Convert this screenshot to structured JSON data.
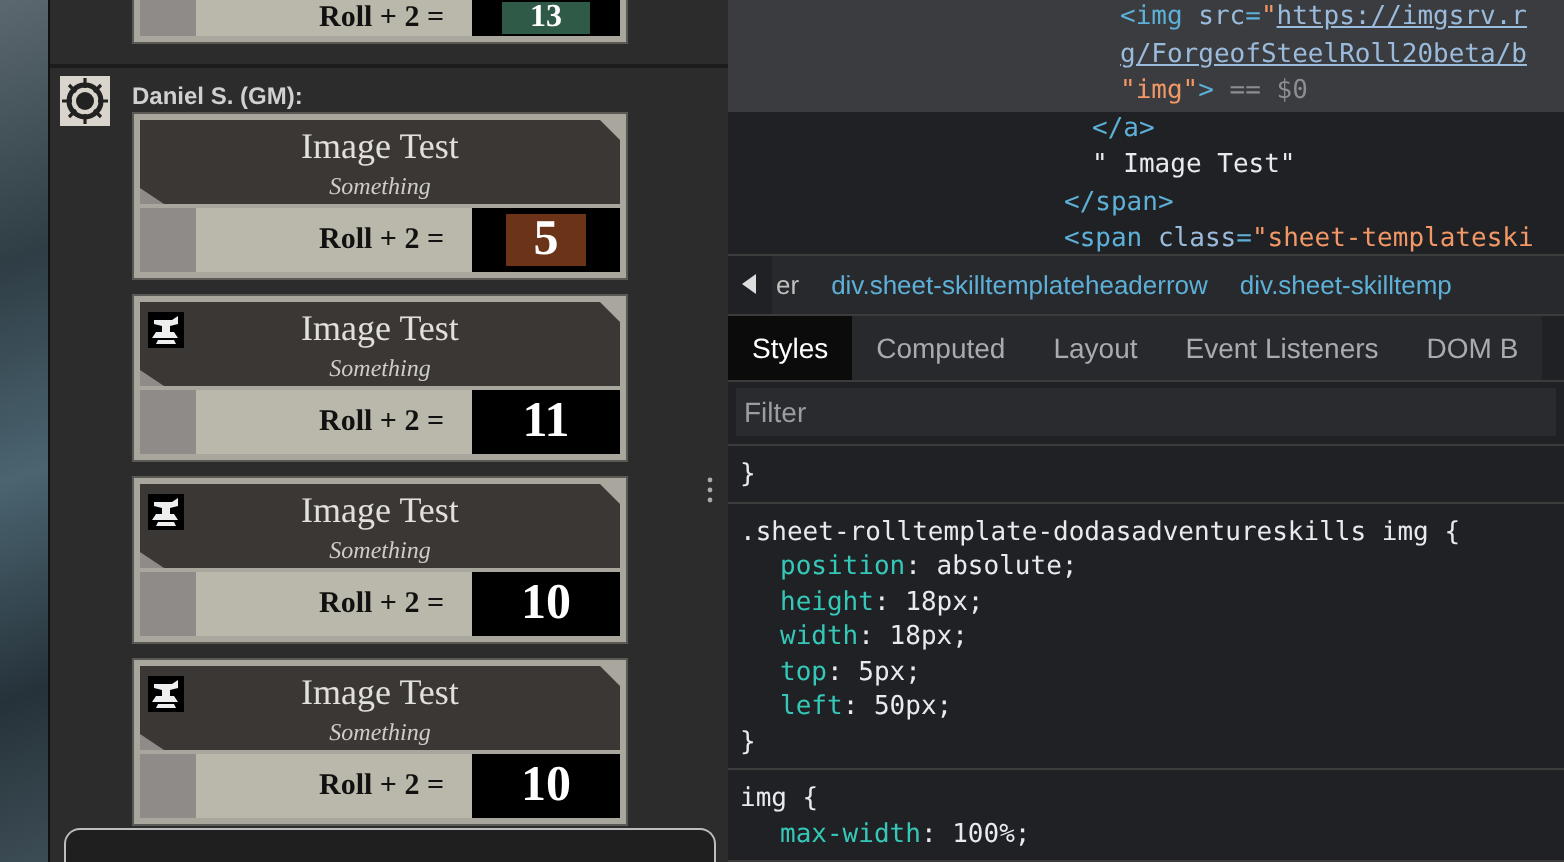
{
  "previous_roll": {
    "label": "Roll + 2 =",
    "result": "13",
    "color": "#2f5a47"
  },
  "message": {
    "sender": "Daniel S. (GM):",
    "rolls": [
      {
        "title": "Image Test",
        "subtitle": "Something",
        "label": "Roll + 2 =",
        "result": "5",
        "color": "#6b3419",
        "icon": false
      },
      {
        "title": "Image Test",
        "subtitle": "Something",
        "label": "Roll + 2 =",
        "result": "11",
        "color": "#000000",
        "icon": true
      },
      {
        "title": "Image Test",
        "subtitle": "Something",
        "label": "Roll + 2 =",
        "result": "10",
        "color": "#000000",
        "icon": true
      },
      {
        "title": "Image Test",
        "subtitle": "Something",
        "label": "Roll + 2 =",
        "result": "10",
        "color": "#000000",
        "icon": true
      }
    ]
  },
  "devtools": {
    "dom_tree": [
      {
        "children": [
          {
            "children": [
              {
                "selected": true,
                "lines": [
                  [
                    {
                      "kind": "tag",
                      "text": "<img "
                    },
                    {
                      "kind": "attr",
                      "text": "src"
                    },
                    {
                      "kind": "tag",
                      "text": "="
                    },
                    {
                      "kind": "value",
                      "text": "\""
                    },
                    {
                      "kind": "link",
                      "text": "https://imgsrv.r"
                    }
                  ],
                  [
                    {
                      "kind": "link",
                      "text": "g/ForgeofSteelRoll20beta/b"
                    }
                  ],
                  [
                    {
                      "kind": "value",
                      "text": "\"img\""
                    },
                    {
                      "kind": "tag",
                      "text": ">"
                    },
                    {
                      "kind": "muted",
                      "text": " == $0"
                    }
                  ]
                ]
              }
            ]
          },
          {
            "selected": false,
            "lines": [
              [
                {
                  "kind": "tag",
                  "text": "</a>"
                }
              ]
            ]
          },
          {
            "selected": false,
            "lines": [
              [
                {
                  "kind": "text",
                  "text": "\" Image Test\""
                }
              ]
            ]
          }
        ]
      },
      {
        "selected": false,
        "lines": [
          [
            {
              "kind": "tag",
              "text": "</span>"
            }
          ]
        ]
      },
      {
        "selected": false,
        "lines": [
          [
            {
              "kind": "tag",
              "text": "<span "
            },
            {
              "kind": "attr",
              "text": "class"
            },
            {
              "kind": "tag",
              "text": "="
            },
            {
              "kind": "value",
              "text": "\"sheet-templateski"
            }
          ]
        ]
      }
    ],
    "breadcrumbs": [
      "er",
      "div.sheet-skilltemplateheaderrow",
      "div.sheet-skilltemp"
    ],
    "tabs": [
      {
        "label": "Styles",
        "selected": true
      },
      {
        "label": "Computed",
        "selected": false
      },
      {
        "label": "Layout",
        "selected": false
      },
      {
        "label": "Event Listeners",
        "selected": false
      },
      {
        "label": "DOM B",
        "selected": false
      }
    ],
    "filter": {
      "placeholder": "Filter"
    },
    "rules": [
      {
        "lines": [
          {
            "kind": "brace",
            "text": "}"
          }
        ]
      },
      {
        "lines": [
          {
            "kind": "selector",
            "text": ".sheet-rolltemplate-dodasadventureskills img {"
          },
          {
            "kind": "declaration",
            "property": "position",
            "value": ": absolute;"
          },
          {
            "kind": "declaration",
            "property": "height",
            "value": ": 18px;"
          },
          {
            "kind": "declaration",
            "property": "width",
            "value": ": 18px;"
          },
          {
            "kind": "declaration",
            "property": "top",
            "value": ": 5px;"
          },
          {
            "kind": "declaration",
            "property": "left",
            "value": ": 50px;"
          },
          {
            "kind": "brace",
            "text": "}"
          }
        ]
      },
      {
        "lines": [
          {
            "kind": "selector",
            "text": "img {"
          },
          {
            "kind": "declaration",
            "property": "max-width",
            "value": ": 100%;"
          }
        ]
      }
    ]
  }
}
